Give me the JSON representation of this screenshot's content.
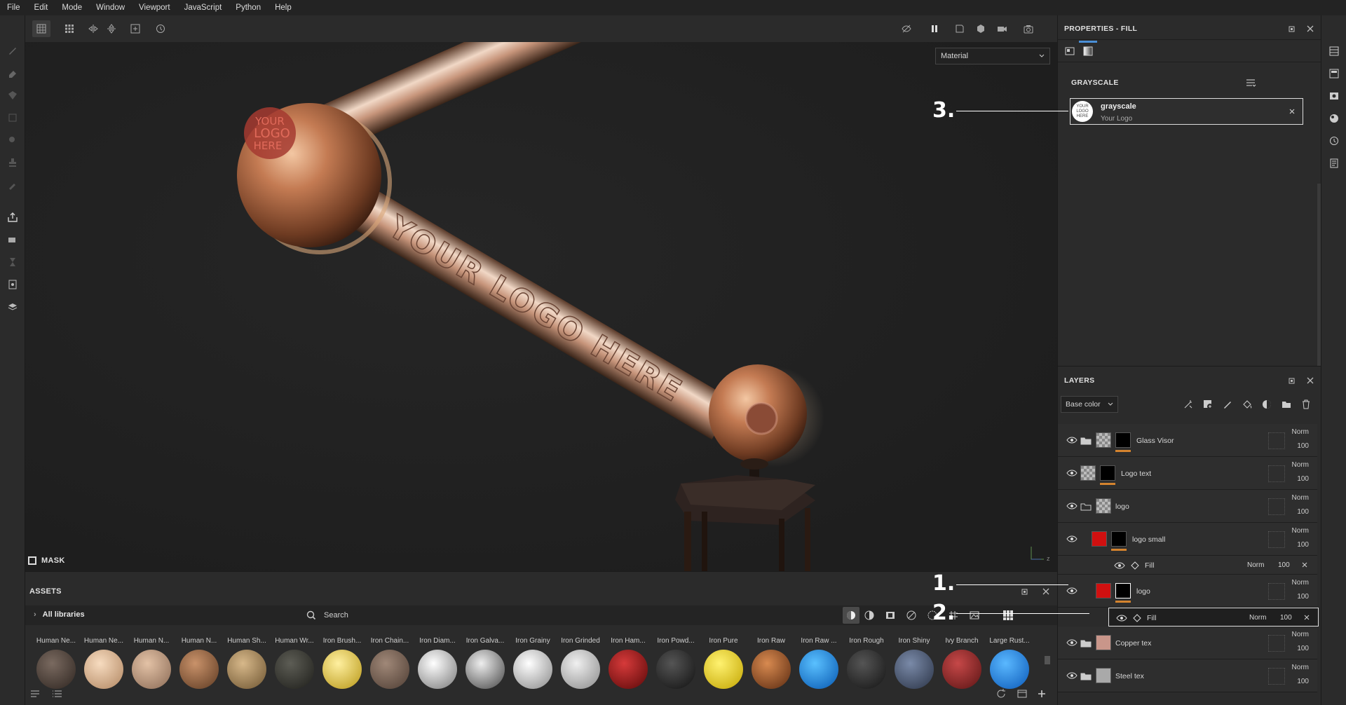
{
  "menu": [
    "File",
    "Edit",
    "Mode",
    "Window",
    "Viewport",
    "JavaScript",
    "Python",
    "Help"
  ],
  "viewport": {
    "mode": "Material",
    "mask_label": "MASK",
    "axis_z": "z"
  },
  "properties": {
    "title": "PROPERTIES - FILL",
    "section": "GRAYSCALE",
    "item_name": "grayscale",
    "item_sub": "Your Logo",
    "logo_lines": [
      "YOUR",
      "LOGO",
      "HERE"
    ]
  },
  "layers": {
    "title": "LAYERS",
    "channel": "Base color",
    "rows": [
      {
        "name": "Glass Visor",
        "blend": "Norm",
        "opacity": "100"
      },
      {
        "name": "Logo text",
        "blend": "Norm",
        "opacity": "100"
      },
      {
        "name": "logo",
        "blend": "Norm",
        "opacity": "100"
      },
      {
        "name": "logo small",
        "blend": "Norm",
        "opacity": "100"
      },
      {
        "name": "Fill",
        "blend": "Norm",
        "opacity": "100"
      },
      {
        "name": "logo",
        "blend": "Norm",
        "opacity": "100"
      },
      {
        "name": "Fill",
        "blend": "Norm",
        "opacity": "100"
      },
      {
        "name": "Copper tex",
        "blend": "Norm",
        "opacity": "100"
      },
      {
        "name": "Steel tex",
        "blend": "Norm",
        "opacity": "100"
      }
    ]
  },
  "assets": {
    "title": "ASSETS",
    "library": "All libraries",
    "search_placeholder": "Search",
    "items": [
      "Human Ne...",
      "Human Ne...",
      "Human N...",
      "Human N...",
      "Human Sh...",
      "Human Wr...",
      "Iron Brush...",
      "Iron Chain...",
      "Iron Diam...",
      "Iron Galva...",
      "Iron Grainy",
      "Iron Grinded",
      "Iron Ham...",
      "Iron Powd...",
      "Iron Pure",
      "Iron Raw",
      "Iron Raw ...",
      "Iron Rough",
      "Iron Shiny",
      "Ivy Branch",
      "Large Rust..."
    ]
  },
  "annotations": [
    "1.",
    "2.",
    "3."
  ],
  "model_text": [
    "YOUR",
    "LOGO",
    "HERE",
    "YOUR LOGO HERE"
  ],
  "colors": {
    "accent": "#d4832e",
    "selection": "#4a8fd6",
    "panel": "#2b2b2b"
  }
}
